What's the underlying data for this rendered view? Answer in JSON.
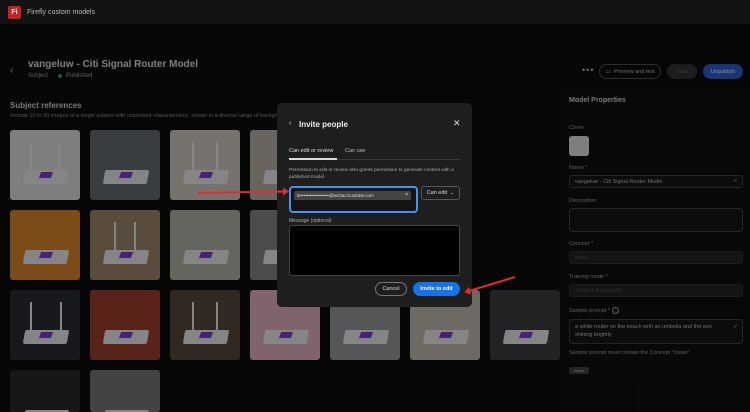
{
  "app": {
    "title": "Firefly custom models",
    "logo_text": "Fi"
  },
  "header": {
    "back_icon": "chevron-left-icon",
    "title": "vangeluw - Citi Signal Router Model",
    "type": "Subject",
    "status": "Published",
    "more_icon": "more-icon",
    "preview_label": "Preview and test",
    "save_label": "Save",
    "unpublish_label": "Unpublish"
  },
  "subject_refs": {
    "title": "Subject references",
    "subtitle": "Include 10 to 30 images of a single subject with consistent characteristics, shown in a diverse range of backgrounds."
  },
  "right_panel": {
    "title": "Model Properties",
    "cover_label": "Cover",
    "name_label": "Name",
    "name_value": "vangeluw - Citi Signal Router Model",
    "description_label": "Description",
    "concept_label": "Concept",
    "concept_value": "router",
    "training_mode_label": "Training mode",
    "training_mode_value": "Subject (fine detail)",
    "sample_prompt_label": "Sample prompt",
    "sample_prompt_value": "a white router on the beach with an umbella and the sun shining brightly",
    "sample_prompt_hint": "Sample prompt must contain the Concept \"router\"",
    "badge": "router",
    "required_mark": "*"
  },
  "modal": {
    "title": "Invite people",
    "back_icon": "chevron-left-icon",
    "close_icon": "close-icon",
    "tabs": [
      "Can edit or review",
      "Can use"
    ],
    "note": "Permission to edit or review also grants permission to generate content with a published model.",
    "email_chip": "tit••••••••••••••••••@techacct.adobe.com",
    "chip_remove": "×",
    "permission": "Can edit",
    "message_label": "Message (optional)",
    "cancel_label": "Cancel",
    "invite_label": "Invite to edit"
  },
  "colors": {
    "accent": "#1473e6",
    "annotation_red": "#e02d2d",
    "published_green": "#2d9d78"
  }
}
